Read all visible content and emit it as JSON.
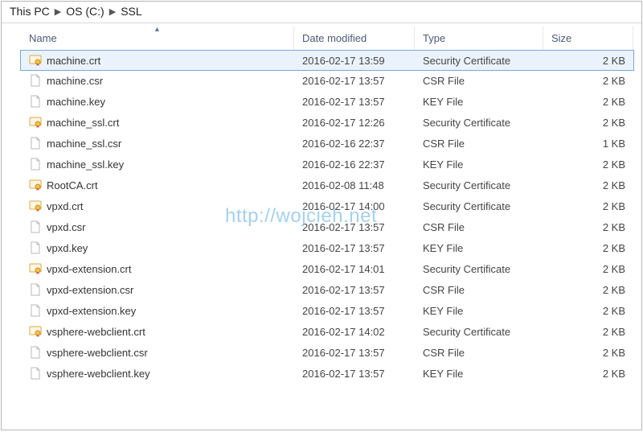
{
  "breadcrumb": {
    "root": "This PC",
    "drive": "OS (C:)",
    "folder": "SSL"
  },
  "columns": {
    "name": "Name",
    "date": "Date modified",
    "type": "Type",
    "size": "Size"
  },
  "icon_types": {
    "cert": "certificate-icon",
    "file": "file-icon"
  },
  "files": [
    {
      "name": "machine.crt",
      "date": "2016-02-17 13:59",
      "type": "Security Certificate",
      "size": "2 KB",
      "icon": "cert",
      "selected": true
    },
    {
      "name": "machine.csr",
      "date": "2016-02-17 13:57",
      "type": "CSR File",
      "size": "2 KB",
      "icon": "file"
    },
    {
      "name": "machine.key",
      "date": "2016-02-17 13:57",
      "type": "KEY File",
      "size": "2 KB",
      "icon": "file"
    },
    {
      "name": "machine_ssl.crt",
      "date": "2016-02-17 12:26",
      "type": "Security Certificate",
      "size": "2 KB",
      "icon": "cert"
    },
    {
      "name": "machine_ssl.csr",
      "date": "2016-02-16 22:37",
      "type": "CSR File",
      "size": "1 KB",
      "icon": "file"
    },
    {
      "name": "machine_ssl.key",
      "date": "2016-02-16 22:37",
      "type": "KEY File",
      "size": "2 KB",
      "icon": "file"
    },
    {
      "name": "RootCA.crt",
      "date": "2016-02-08 11:48",
      "type": "Security Certificate",
      "size": "2 KB",
      "icon": "cert"
    },
    {
      "name": "vpxd.crt",
      "date": "2016-02-17 14:00",
      "type": "Security Certificate",
      "size": "2 KB",
      "icon": "cert"
    },
    {
      "name": "vpxd.csr",
      "date": "2016-02-17 13:57",
      "type": "CSR File",
      "size": "2 KB",
      "icon": "file"
    },
    {
      "name": "vpxd.key",
      "date": "2016-02-17 13:57",
      "type": "KEY File",
      "size": "2 KB",
      "icon": "file"
    },
    {
      "name": "vpxd-extension.crt",
      "date": "2016-02-17 14:01",
      "type": "Security Certificate",
      "size": "2 KB",
      "icon": "cert"
    },
    {
      "name": "vpxd-extension.csr",
      "date": "2016-02-17 13:57",
      "type": "CSR File",
      "size": "2 KB",
      "icon": "file"
    },
    {
      "name": "vpxd-extension.key",
      "date": "2016-02-17 13:57",
      "type": "KEY File",
      "size": "2 KB",
      "icon": "file"
    },
    {
      "name": "vsphere-webclient.crt",
      "date": "2016-02-17 14:02",
      "type": "Security Certificate",
      "size": "2 KB",
      "icon": "cert"
    },
    {
      "name": "vsphere-webclient.csr",
      "date": "2016-02-17 13:57",
      "type": "CSR File",
      "size": "2 KB",
      "icon": "file"
    },
    {
      "name": "vsphere-webclient.key",
      "date": "2016-02-17 13:57",
      "type": "KEY File",
      "size": "2 KB",
      "icon": "file"
    }
  ],
  "watermark": "http://wojcieh.net"
}
